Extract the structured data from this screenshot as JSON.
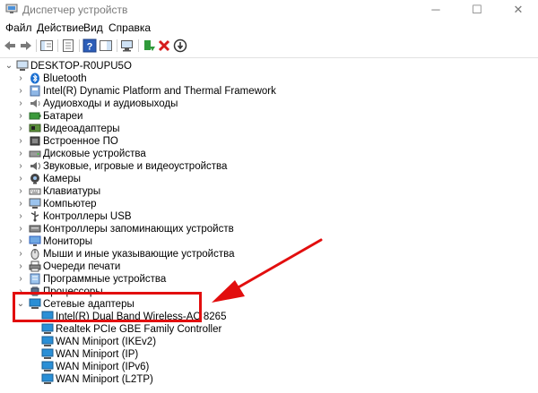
{
  "window": {
    "title": "Диспетчер устройств",
    "minimize_glyph": "─",
    "maximize_glyph": "☐",
    "close_glyph": "✕"
  },
  "menu": [
    "Файл",
    "Действие",
    "Вид",
    "Справка"
  ],
  "toolbar_icons": [
    "back-icon",
    "forward-icon",
    "show-hide-console-tree-icon",
    "properties-icon",
    "help-icon",
    "action-pane-icon",
    "scan-hardware-icon",
    "update-driver-icon",
    "uninstall-icon",
    "disable-device-icon"
  ],
  "tree": {
    "root": "DESKTOP-R0UPU5O",
    "categories": [
      "Bluetooth",
      "Intel(R) Dynamic Platform and Thermal Framework",
      "Аудиовходы и аудиовыходы",
      "Батареи",
      "Видеоадаптеры",
      "Встроенное ПО",
      "Дисковые устройства",
      "Звуковые, игровые и видеоустройства",
      "Камеры",
      "Клавиатуры",
      "Компьютер",
      "Контроллеры USB",
      "Контроллеры запоминающих устройств",
      "Мониторы",
      "Мыши и иные указывающие устройства",
      "Очереди печати",
      "Программные устройства",
      "Процессоры"
    ],
    "expanded": {
      "label": "Сетевые адаптеры",
      "children": [
        "Intel(R) Dual Band Wireless-AC 8265",
        "Realtek PCIe GBE Family Controller",
        "WAN Miniport (IKEv2)",
        "WAN Miniport (IP)",
        "WAN Miniport (IPv6)",
        "WAN Miniport (L2TP)"
      ]
    }
  },
  "colors": {
    "highlight": "#e20e0e",
    "net_adapter": "#2a8fd6"
  }
}
